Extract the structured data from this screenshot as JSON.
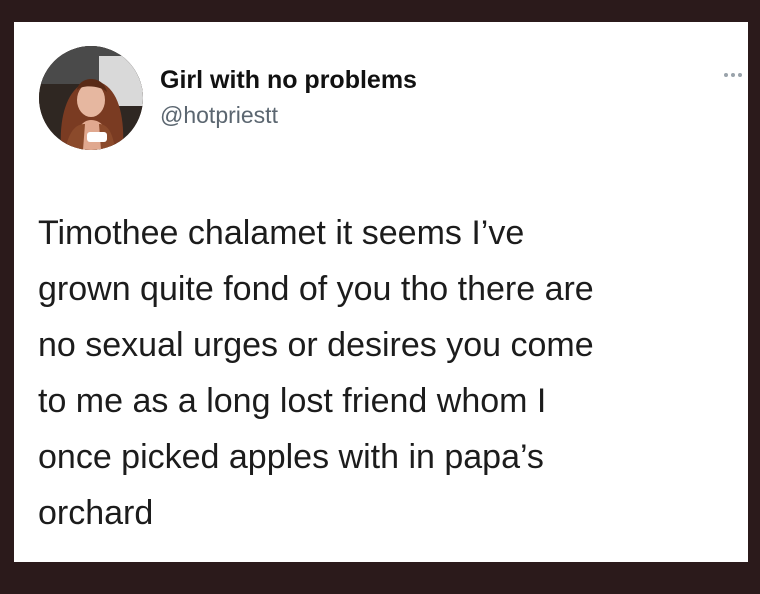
{
  "tweet": {
    "display_name": "Girl with no problems",
    "handle": "@hotpriestt",
    "text": "Timothee chalamet it seems I’ve\ngrown quite fond of you tho there are\nno sexual urges or desires you come\nto me as a long lost friend whom I\nonce picked apples with in papa’s\norchard"
  },
  "icons": {
    "avatar": "profile-photo",
    "more": "more-options-icon"
  },
  "colors": {
    "frame": "#2b1a1b",
    "card_background": "#ffffff",
    "text_primary": "#111111",
    "text_secondary": "#5b6670"
  }
}
